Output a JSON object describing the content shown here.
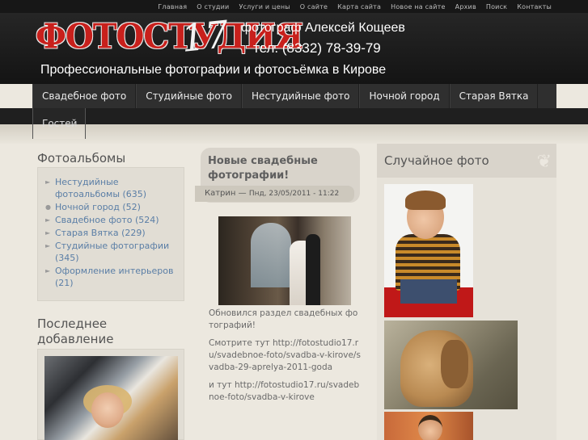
{
  "top_links": [
    "Главная",
    "О студии",
    "Услуги и цены",
    "О сайте",
    "Карта сайта",
    "Новое на сайте",
    "Архив",
    "Поиск",
    "Контакты"
  ],
  "header": {
    "logo_text": "ФОТОСТУДИЯ",
    "logo_number": "17",
    "photographer": "фотограф Алексей Кощеев",
    "phone": "тел. (8332) 78-39-79",
    "tagline": "Профессиональные фотографии и фотосъёмка в Кирове"
  },
  "nav": {
    "items": [
      "Свадебное фото",
      "Студийные фото",
      "Нестудийные фото",
      "Ночной город",
      "Старая Вятка"
    ],
    "overflow_item": "Гостей"
  },
  "albums": {
    "title": "Фотоальбомы",
    "items": [
      {
        "label": "Нестудийные фотоальбомы (635)"
      },
      {
        "label": "Ночной город (52)"
      },
      {
        "label": "Свадебное фото (524)"
      },
      {
        "label": "Старая Вятка (229)"
      },
      {
        "label": "Студийные фотографии (345)"
      },
      {
        "label": "Оформление интерьеров (21)"
      }
    ]
  },
  "latest": {
    "title": "Последнее добавление"
  },
  "post": {
    "title": "Новые свадебные фотографии!",
    "author": "Катрин",
    "date": "Пнд, 23/05/2011 - 11:22",
    "body": [
      "Обновился раздел свадебных фотографий!",
      "Смотрите тут http://fotostudio17.ru/svadebnoe-foto/svadba-v-kirove/svadba-29-aprelya-2011-goda",
      "и тут http://fotostudio17.ru/svadebnoe-foto/svadba-v-kirove"
    ]
  },
  "random": {
    "title": "Случайное фото"
  }
}
